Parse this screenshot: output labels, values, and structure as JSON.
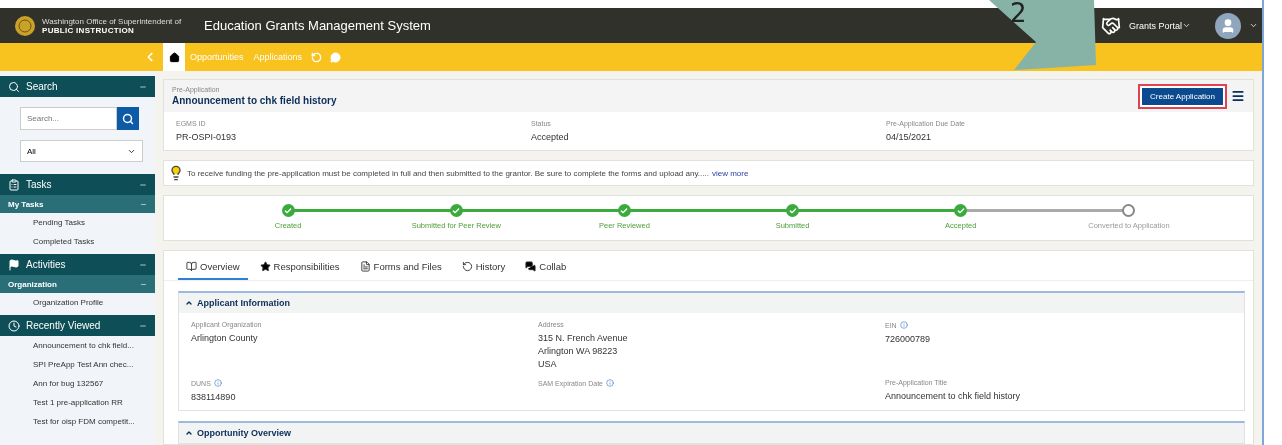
{
  "header": {
    "logo_small": "Washington Office of Superintendent of",
    "logo_main": "PUBLIC INSTRUCTION",
    "title": "Education Grants Management System",
    "portal": "Grants Portal"
  },
  "nav": {
    "links": [
      "Opportunities",
      "Applications"
    ]
  },
  "callout": {
    "label": "2"
  },
  "sidebar": {
    "sections": [
      {
        "kind": "search",
        "title": "Search",
        "placeholder": "Search...",
        "filter": "All"
      },
      {
        "kind": "tasks",
        "title": "Tasks",
        "groups": [
          {
            "title": "My Tasks",
            "items": [
              "Pending Tasks",
              "Completed Tasks"
            ]
          }
        ]
      },
      {
        "kind": "activities",
        "title": "Activities",
        "groups": [
          {
            "title": "Organization",
            "items": [
              "Organization Profile"
            ]
          }
        ]
      },
      {
        "kind": "recent",
        "title": "Recently Viewed",
        "groups": [
          {
            "items": [
              "Announcement to chk field...",
              "SPI PreApp Test Ann chec...",
              "Ann for bug 132567",
              "Test 1 pre-application RR",
              "Test for oisp FDM competit..."
            ]
          }
        ]
      }
    ]
  },
  "record": {
    "type": "Pre-Application",
    "title": "Announcement to chk field history",
    "action": {
      "label": "Create Application",
      "highlighted": true
    },
    "fields": [
      {
        "label": "EGMS ID",
        "value": "PR-OSPI-0193"
      },
      {
        "label": "Status",
        "value": "Accepted"
      },
      {
        "label": "Pre-Application Due Date",
        "value": "04/15/2021"
      }
    ]
  },
  "notice": {
    "text": "To receive funding the pre-application must be completed in full and then submitted to the grantor. Be sure to complete the forms and upload any.....",
    "link": "view more"
  },
  "progress": [
    {
      "label": "Created",
      "completed": true
    },
    {
      "label": "Submitted for Peer Review",
      "completed": true
    },
    {
      "label": "Peer Reviewed",
      "completed": true
    },
    {
      "label": "Submitted",
      "completed": true
    },
    {
      "label": "Accepted",
      "completed": true
    },
    {
      "label": "Converted to Application",
      "completed": false
    }
  ],
  "tabs": [
    {
      "label": "Overview",
      "kind": "overview",
      "selected": true
    },
    {
      "label": "Responsibilities",
      "kind": "star",
      "selected": false
    },
    {
      "label": "Forms and Files",
      "kind": "file",
      "selected": false
    },
    {
      "label": "History",
      "kind": "history",
      "selected": false
    },
    {
      "label": "Collab",
      "kind": "chat",
      "selected": false
    }
  ],
  "sections": [
    {
      "title": "Applicant Information",
      "expanded": true,
      "fields": [
        {
          "label": "Applicant Organization",
          "lines": [
            "Arlington County"
          ]
        },
        {
          "label": "Address",
          "lines": [
            "315 N. French Avenue",
            "Arlington WA 98223",
            "USA"
          ]
        },
        {
          "label": "EIN",
          "info": true,
          "lines": [
            "726000789"
          ]
        },
        {
          "label": "DUNS",
          "info": true,
          "lines": [
            "838114890"
          ]
        },
        {
          "label": "SAM Expiration Date",
          "info": true
        },
        {
          "label": "Pre-Application Title",
          "lines": [
            "Announcement to chk field history"
          ]
        }
      ]
    },
    {
      "title": "Opportunity Overview",
      "expanded": true
    }
  ]
}
